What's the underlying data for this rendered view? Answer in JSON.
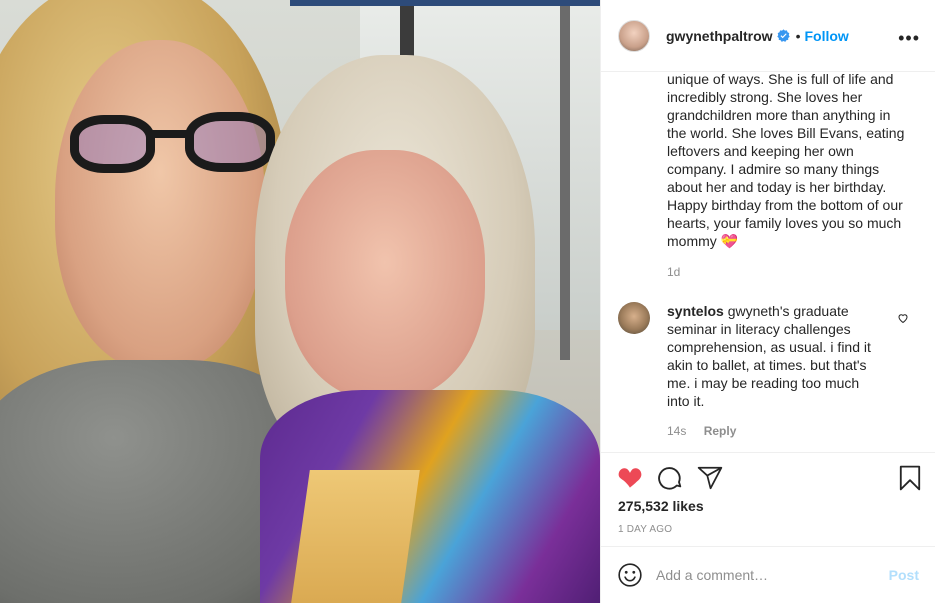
{
  "post": {
    "username": "gwynethpaltrow",
    "verified": true,
    "separator": "•",
    "follow_label": "Follow",
    "more_label": "•••"
  },
  "caption": {
    "lines": [
      "unique of ways. She is full of life and",
      "incredibly strong. She loves her",
      "grandchildren more than anything in",
      "the world. She loves Bill Evans, eating",
      "leftovers and keeping her own",
      "company. I admire so many things",
      "about her and today is her birthday.",
      "Happy birthday from the bottom of our",
      "hearts, your family loves you so much",
      "mommy 💝"
    ],
    "time": "1d"
  },
  "comment": {
    "username": "syntelos",
    "text": "gwyneth's graduate seminar in literacy challenges comprehension, as usual. i find it akin to ballet, at times. but that's me. i may be reading too much into it.",
    "time": "14s",
    "reply_label": "Reply"
  },
  "actions": {
    "likes": "275,532 likes",
    "ago": "1 DAY AGO",
    "liked": true,
    "like_color": "#ed4956"
  },
  "add_comment": {
    "placeholder": "Add a comment…",
    "post_label": "Post"
  },
  "colors": {
    "accent": "#0095f6",
    "muted": "#8e8e8e",
    "post_disabled": "#b2dffc"
  }
}
